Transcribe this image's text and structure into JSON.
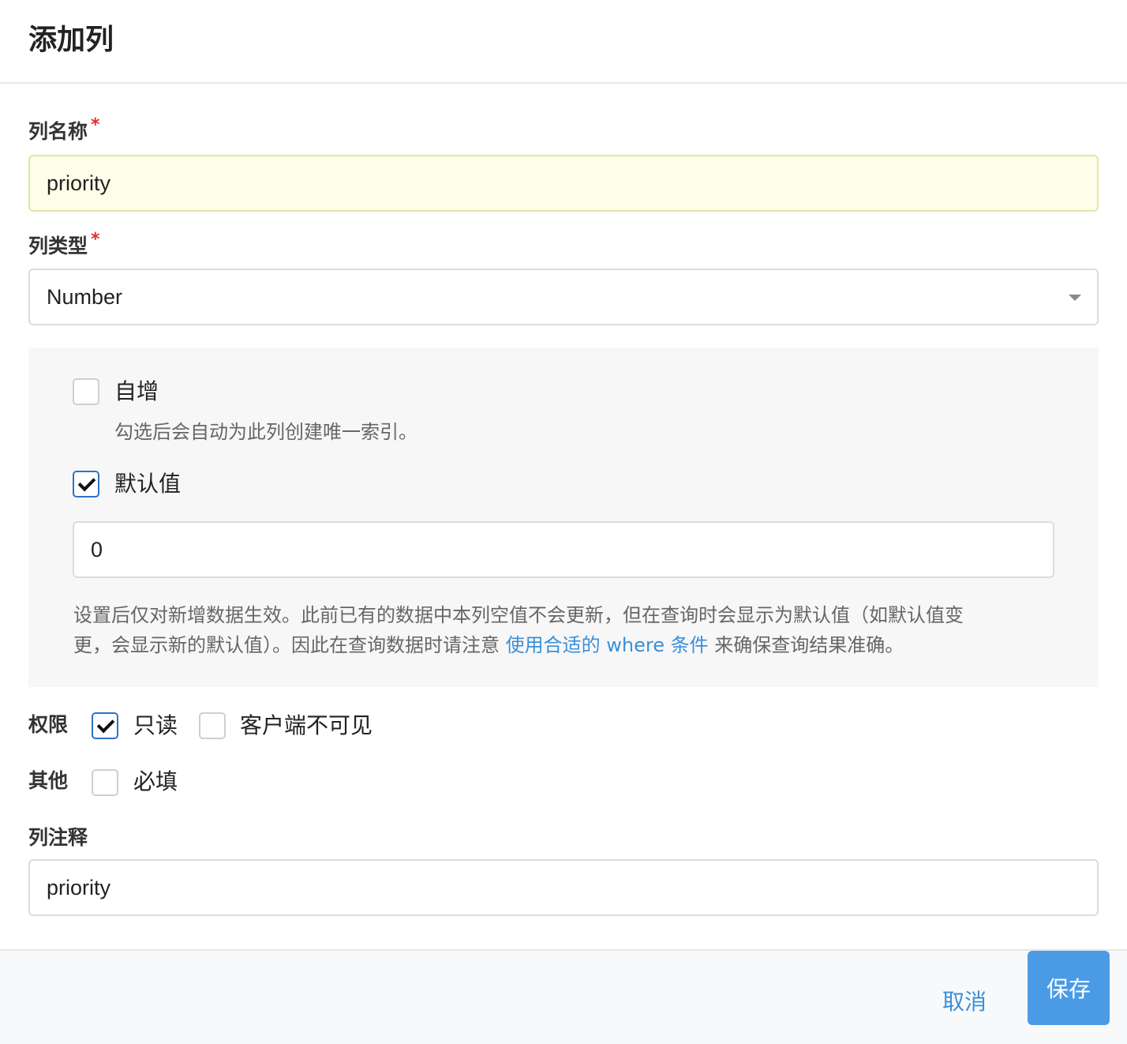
{
  "dialog": {
    "title": "添加列"
  },
  "fields": {
    "name_label": "列名称",
    "required_mark": "*",
    "name_value": "priority",
    "type_label": "列类型",
    "type_value": "Number",
    "comment_label": "列注释",
    "comment_value": "priority"
  },
  "options": {
    "auto_increment": {
      "label": "自增",
      "checked": false,
      "hint": "勾选后会自动为此列创建唯一索引。"
    },
    "default_value": {
      "label": "默认值",
      "checked": true,
      "value": "0"
    },
    "default_hint_part1": "设置后仅对新增数据生效。此前已有的数据中本列空值不会更新，但在查询时会显示为默认值（如默认值变",
    "default_hint_part2": "更，会显示新的默认值）。因此在查询数据时请注意",
    "default_hint_link": "使用合适的 where 条件",
    "default_hint_part3": "来确保查询结果准确。"
  },
  "permissions": {
    "label": "权限",
    "readonly": {
      "label": "只读",
      "checked": true
    },
    "client_invisible": {
      "label": "客户端不可见",
      "checked": false
    }
  },
  "other": {
    "label": "其他",
    "required": {
      "label": "必填",
      "checked": false
    }
  },
  "footer": {
    "cancel_label": "取消",
    "save_label": "保存"
  },
  "colors": {
    "accent": "#4a9be6",
    "link": "#3b8fd9",
    "required": "#e0312f",
    "highlight_bg": "#fdfde8"
  }
}
